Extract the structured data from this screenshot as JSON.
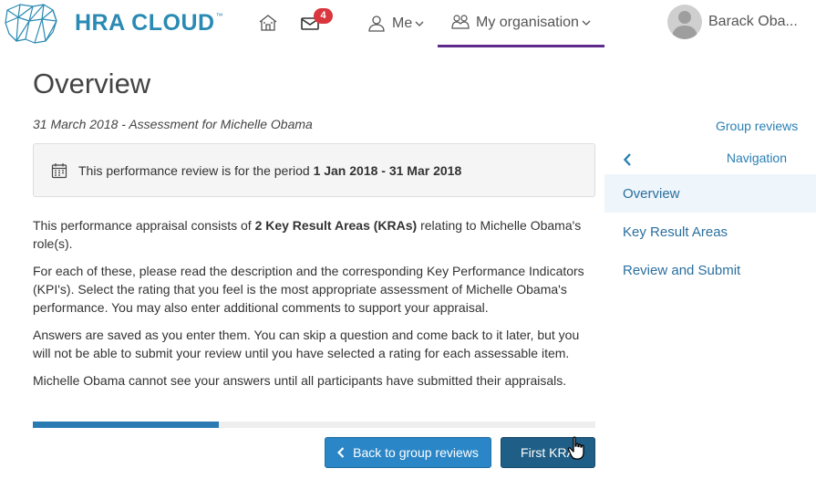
{
  "header": {
    "brand": "HRA CLOUD",
    "brand_tm": "™",
    "mail_badge_count": "4",
    "me_label": "Me",
    "org_label": "My organisation",
    "user_name": "Barack Oba...",
    "icons": {
      "home": "home-icon",
      "mail": "mail-icon",
      "me": "person-icon",
      "org": "people-icon"
    },
    "colors": {
      "brand": "#2a8ab3",
      "active_tab_underline": "#5e2b8a",
      "badge": "#d9363e"
    }
  },
  "page": {
    "title": "Overview",
    "subtitle": "31 March 2018 - Assessment for Michelle Obama",
    "period": {
      "prefix": "This performance review is for the period ",
      "range": "1 Jan 2018 - 31 Mar 2018"
    },
    "paragraphs": {
      "p1_a": "This performance appraisal consists of ",
      "p1_bold": "2 Key Result Areas (KRAs)",
      "p1_b": " relating to Michelle Obama's role(s).",
      "p2": "For each of these, please read the description and the corresponding Key Performance Indicators (KPI's). Select the rating that you feel is the most appropriate assessment of Michelle Obama's performance. You may also enter additional comments to support your appraisal.",
      "p3": "Answers are saved as you enter them. You can skip a question and come back to it later, but you will not be able to submit your review until you have selected a rating for each assessable item.",
      "p4": "Michelle Obama cannot see your answers until all participants have submitted their appraisals."
    },
    "progress_fraction": 0.33,
    "buttons": {
      "back": "Back to group reviews",
      "first": "First KRA"
    }
  },
  "sidebar": {
    "group_reviews_link": "Group reviews",
    "nav_title": "Navigation",
    "items": [
      {
        "label": "Overview",
        "active": true
      },
      {
        "label": "Key Result Areas",
        "active": false
      },
      {
        "label": "Review and Submit",
        "active": false
      }
    ]
  }
}
